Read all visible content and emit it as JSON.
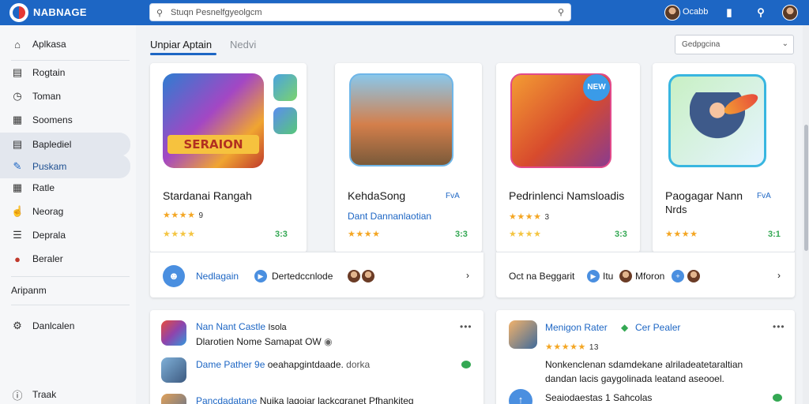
{
  "topbar": {
    "brand": "NABNAGE",
    "search_value": "Stuqn Pesnelfgyeolgcm",
    "user_name": "Ocabb"
  },
  "sidebar": {
    "title": "Aplkasa",
    "items": [
      {
        "label": "Rogtain",
        "icon": "doc-icon"
      },
      {
        "label": "Toman",
        "icon": "clock-icon"
      },
      {
        "label": "Soomens",
        "icon": "grid-icon"
      },
      {
        "label": "Baplediel",
        "icon": "card-icon"
      },
      {
        "label": "Puskam",
        "icon": "pen-icon"
      },
      {
        "label": "Ratle",
        "icon": "grid-icon"
      },
      {
        "label": "Neorag",
        "icon": "hand-icon"
      },
      {
        "label": "Deprala",
        "icon": "list-icon"
      },
      {
        "label": "Beraler",
        "icon": "ball-icon"
      }
    ],
    "section_head": "Aripanm",
    "bottom_items": [
      {
        "label": "Danlcalen",
        "icon": "gear-icon"
      },
      {
        "label": "Traak",
        "icon": "info-icon"
      }
    ]
  },
  "tabs": [
    {
      "label": "Unpiar Aptain",
      "active": true
    },
    {
      "label": "Nedvi",
      "active": false
    }
  ],
  "sort": {
    "label": "Gedpgcina"
  },
  "featured": [
    {
      "name": "Stardanai Rangah",
      "rating": "★★★★",
      "count": "9",
      "rating2": "★★★★",
      "green": "3:3"
    },
    {
      "name": "KehdaSong",
      "sub": "Dant Dannanlaotian",
      "tag": "FvA",
      "rating": "★★★★",
      "green": "3:3"
    },
    {
      "name": "Pedrinlenci Namsloadis",
      "rating": "★★★★",
      "count": "3",
      "rating2": "★★★★",
      "green": "3:3"
    },
    {
      "name": "Paogagar Nann",
      "name2": "Nrds",
      "tag": "FvA",
      "rating": "★★★★",
      "green": "3:1"
    }
  ],
  "bar1": {
    "left_label": "Nedlagain",
    "mid_label": "Dertedccnlode",
    "end": "›"
  },
  "bar2": {
    "left_label": "Oct na Beggarit",
    "mid_label": "Itu",
    "mid_label2": "Mforon",
    "end": "›"
  },
  "list_left": [
    {
      "title": "Nan Nant Castle",
      "title2": "Isola",
      "sub": "Dlarotien Nome Samapat OW"
    },
    {
      "title": "Dame Pather 9e",
      "title2": "oeahapgintdaade.",
      "title3": "dorka"
    },
    {
      "title": "Pancdadatane",
      "title2": "Nuika",
      "title3": "lagoiar lackcgranet Pfhankiteg"
    }
  ],
  "list_right": {
    "title": "Menigon Rater",
    "tag": "Cer Pealer",
    "rating": "★★★★★",
    "count": "13",
    "desc1": "Nonkenclenan sdamdekane alriladeatetaraltian",
    "desc2": "dandan lacis gaygolinada leatand aseooel.",
    "bottom": "Seaiodaestas 1 Sahcolas"
  },
  "more": "•••"
}
